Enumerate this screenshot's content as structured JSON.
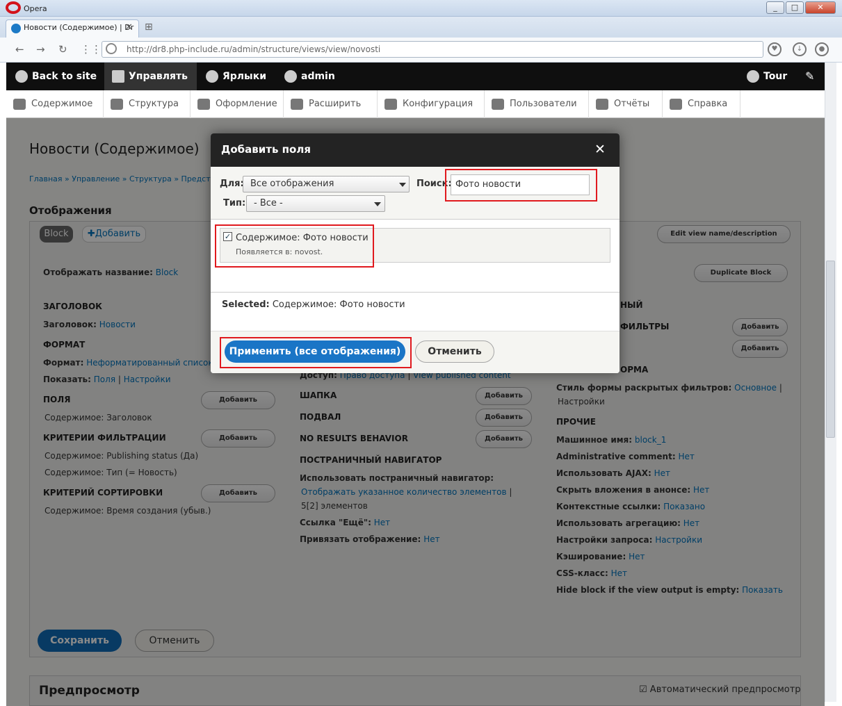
{
  "browser": {
    "app_name": "Opera",
    "tab_title": "Новости (Содержимое) | Dr",
    "url": "http://dr8.php-include.ru/admin/structure/views/view/novosti",
    "window_buttons": [
      "_",
      "□",
      "✕"
    ]
  },
  "toolbar": {
    "back": "Back to site",
    "manage": "Управлять",
    "shortcuts": "Ярлыки",
    "user": "admin",
    "tour": "Tour"
  },
  "tray": [
    "Содержимое",
    "Структура",
    "Оформление",
    "Расширить",
    "Конфигурация",
    "Пользователи",
    "Отчёты",
    "Справка"
  ],
  "page": {
    "title": "Новости (Содержимое)",
    "breadcrumb": "Главная » Управление » Структура » Представл",
    "displays_heading": "Отображения",
    "tab_block": "Block",
    "tab_add": "✚Добавить",
    "edit_name_btn": "Edit view name/description",
    "duplicate_btn": "Duplicate Block",
    "display_name_label": "Отображать название:",
    "display_name_value": "Block",
    "col1": {
      "title_h": "ЗАГОЛОВОК",
      "title_label": "Заголовок:",
      "title_value": "Новости",
      "format_h": "ФОРМАТ",
      "format_label": "Формат:",
      "format_value": "Неформатированный список",
      "show_label": "Показать:",
      "show_value1": "Поля",
      "show_value2": "Настройки",
      "fields_h": "ПОЛЯ",
      "fields_item": "Содержимое: Заголовок",
      "filter_h": "КРИТЕРИИ ФИЛЬТРАЦИИ",
      "filter_item1": "Содержимое: Publishing status (Да)",
      "filter_item2": "Содержимое: Тип (= Новость)",
      "sort_h": "КРИТЕРИЙ СОРТИРОВКИ",
      "sort_item": "Содержимое: Время создания (убыв.)",
      "add": "Добавить"
    },
    "col2": {
      "access_label": "Доступ:",
      "access_value1": "Право доступа",
      "access_value2": "View published content",
      "header_h": "ШАПКА",
      "footer_h": "ПОДВАЛ",
      "noresults_h": "NO RESULTS BEHAVIOR",
      "pager_h": "ПОСТРАНИЧНЫЙ НАВИГАТОР",
      "pager_label": "Использовать постраничный навигатор:",
      "pager_value1": "Отображать указанное количество элементов",
      "pager_value2": "5[2] элементов",
      "more_label": "Ссылка \"Ещё\":",
      "more_value": "Нет",
      "attach_label": "Привязать отображение:",
      "attach_value": "Нет",
      "add": "Добавить"
    },
    "col3": {
      "adv_h_tail": "НЫЙ",
      "filters_tail": "ФИЛЬТРЫ",
      "form_tail": "ОРМА",
      "form_style_label": "Стиль формы раскрытых фильтров:",
      "form_style_value": "Основное",
      "form_style_settings": "Настройки",
      "other_h": "ПРОЧИЕ",
      "rows": [
        {
          "label": "Машинное имя:",
          "value": "block_1"
        },
        {
          "label": "Administrative comment:",
          "value": "Нет"
        },
        {
          "label": "Использовать AJAX:",
          "value": "Нет"
        },
        {
          "label": "Скрыть вложения в анонсе:",
          "value": "Нет"
        },
        {
          "label": "Контекстные ссылки:",
          "value": "Показано"
        },
        {
          "label": "Использовать агрегацию:",
          "value": "Нет"
        },
        {
          "label": "Настройки запроса:",
          "value": "Настройки"
        },
        {
          "label": "Кэширование:",
          "value": "Нет"
        },
        {
          "label": "CSS-класс:",
          "value": "Нет"
        },
        {
          "label": "Hide block if the view output is empty:",
          "value": "Показать"
        }
      ],
      "add": "Добавить"
    },
    "save": "Сохранить",
    "cancel": "Отменить",
    "preview_h": "Предпросмотр",
    "auto_preview": "Автоматический предпросмотр"
  },
  "dialog": {
    "title": "Добавить поля",
    "close": "✕",
    "for_label": "Для:",
    "for_value": "Все отображения",
    "search_label": "Поиск:",
    "search_value": "Фото новости",
    "type_label": "Тип:",
    "type_value": "- Все -",
    "result_title": "Содержимое: Фото новости",
    "result_sub": "Появляется в: novost.",
    "selected_label": "Selected:",
    "selected_value": "Содержимое: Фото новости",
    "apply": "Применить (все отображения)",
    "cancel": "Отменить"
  },
  "colors": {
    "accent": "#0074bd",
    "highlight": "#e0191e",
    "toolbar": "#0f0f0f"
  }
}
